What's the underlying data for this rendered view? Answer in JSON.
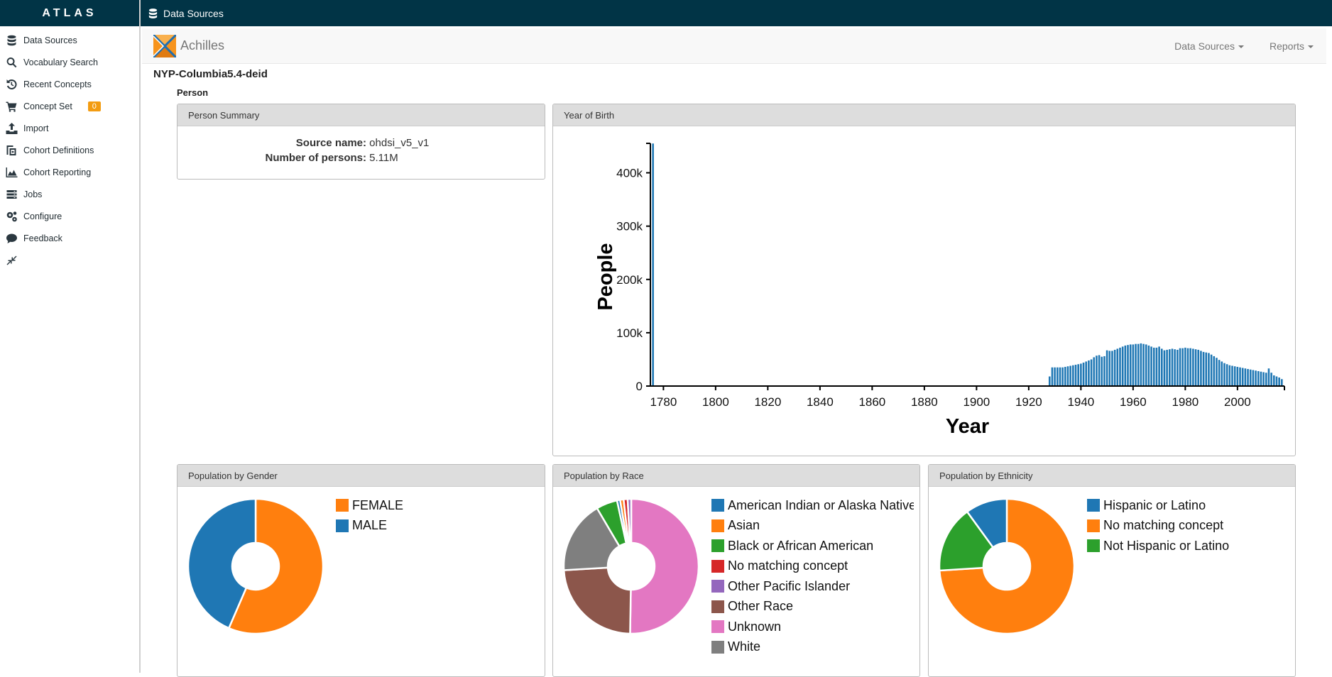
{
  "app": {
    "brand": "ATLAS",
    "page_title": "Data Sources"
  },
  "sidebar": {
    "items": [
      {
        "label": "Data Sources",
        "icon": "database-icon"
      },
      {
        "label": "Vocabulary Search",
        "icon": "search-icon"
      },
      {
        "label": "Recent Concepts",
        "icon": "history-icon"
      },
      {
        "label": "Concept Set",
        "icon": "cart-icon",
        "badge": "0"
      },
      {
        "label": "Import",
        "icon": "upload-icon"
      },
      {
        "label": "Cohort Definitions",
        "icon": "cohort-icon"
      },
      {
        "label": "Cohort Reporting",
        "icon": "area-chart-icon"
      },
      {
        "label": "Jobs",
        "icon": "jobs-icon"
      },
      {
        "label": "Configure",
        "icon": "gears-icon"
      },
      {
        "label": "Feedback",
        "icon": "comment-icon"
      },
      {
        "label": "",
        "icon": "compress-icon"
      }
    ]
  },
  "achilles": {
    "title": "Achilles",
    "menu_data_sources": "Data Sources",
    "menu_reports": "Reports"
  },
  "source": {
    "name": "NYP-Columbia5.4-deid",
    "section": "Person"
  },
  "summary": {
    "title": "Person Summary",
    "source_label": "Source name:",
    "source_value": "ohdsi_v5_v1",
    "persons_label": "Number of persons:",
    "persons_value": "5.11M"
  },
  "charts": {
    "yob_title": "Year of Birth",
    "gender_title": "Population by Gender",
    "race_title": "Population by Race",
    "ethnicity_title": "Population by Ethnicity"
  },
  "colors": {
    "navy": "#013446",
    "bar": "#1f77b4",
    "badge": "#f39c12"
  },
  "chart_data": [
    {
      "type": "bar",
      "title": "Year of Birth",
      "xlabel": "Year",
      "ylabel": "People",
      "xlim": [
        1775,
        2018
      ],
      "ylim": [
        0,
        450000
      ],
      "x_ticks": [
        "1780",
        "1800",
        "1820",
        "1840",
        "1860",
        "1880",
        "1900",
        "1920",
        "1940",
        "1960",
        "1980",
        "2000"
      ],
      "y_ticks": [
        "0",
        "100k",
        "200k",
        "300k",
        "400k"
      ],
      "x": [
        1776,
        1928,
        1929,
        1930,
        1931,
        1932,
        1933,
        1934,
        1935,
        1936,
        1937,
        1938,
        1939,
        1940,
        1941,
        1942,
        1943,
        1944,
        1945,
        1946,
        1947,
        1948,
        1949,
        1950,
        1951,
        1952,
        1953,
        1954,
        1955,
        1956,
        1957,
        1958,
        1959,
        1960,
        1961,
        1962,
        1963,
        1964,
        1965,
        1966,
        1967,
        1968,
        1969,
        1970,
        1971,
        1972,
        1973,
        1974,
        1975,
        1976,
        1977,
        1978,
        1979,
        1980,
        1981,
        1982,
        1983,
        1984,
        1985,
        1986,
        1987,
        1988,
        1989,
        1990,
        1991,
        1992,
        1993,
        1994,
        1995,
        1996,
        1997,
        1998,
        1999,
        2000,
        2001,
        2002,
        2003,
        2004,
        2005,
        2006,
        2007,
        2008,
        2009,
        2010,
        2011,
        2012,
        2013,
        2014,
        2015,
        2016,
        2017
      ],
      "values": [
        455000,
        18000,
        35000,
        35000,
        35000,
        35000,
        35000,
        36000,
        37000,
        38000,
        39000,
        40000,
        41000,
        42000,
        44000,
        46000,
        48000,
        50000,
        54000,
        57000,
        58000,
        55000,
        56000,
        67000,
        66000,
        66000,
        68000,
        70000,
        72000,
        74000,
        76000,
        77000,
        78000,
        78000,
        79000,
        79000,
        80000,
        79000,
        78000,
        76000,
        74000,
        72000,
        72000,
        74000,
        70000,
        67000,
        68000,
        69000,
        70000,
        69000,
        68000,
        71000,
        71000,
        72000,
        71000,
        71000,
        70000,
        69000,
        68000,
        66000,
        64000,
        63000,
        62000,
        59000,
        56000,
        53000,
        49000,
        46000,
        43000,
        41000,
        39000,
        38000,
        37000,
        36000,
        35000,
        34000,
        33000,
        32000,
        31000,
        30000,
        29000,
        28000,
        27000,
        26000,
        25000,
        33000,
        25000,
        20000,
        18000,
        16000,
        13000
      ]
    },
    {
      "type": "pie",
      "title": "Population by Gender",
      "categories": [
        "FEMALE",
        "MALE"
      ],
      "values": [
        56.5,
        43.5
      ],
      "colors": [
        "#ff7f0e",
        "#1f77b4"
      ]
    },
    {
      "type": "pie",
      "title": "Population by Race",
      "categories": [
        "American Indian or Alaska Native",
        "Asian",
        "Black or African American",
        "No matching concept",
        "Other Pacific Islander",
        "Other Race",
        "Unknown",
        "White"
      ],
      "values": [
        0.7,
        0.8,
        4.8,
        0.9,
        0.8,
        22.5,
        47.5,
        16.5
      ],
      "colors": [
        "#1f77b4",
        "#ff7f0e",
        "#2ca02c",
        "#d62728",
        "#9467bd",
        "#8c564b",
        "#e377c2",
        "#7f7f7f"
      ],
      "order": [
        6,
        5,
        7,
        2,
        0,
        1,
        3,
        4
      ]
    },
    {
      "type": "pie",
      "title": "Population by Ethnicity",
      "categories": [
        "Hispanic or Latino",
        "No matching concept",
        "Not Hispanic or Latino"
      ],
      "values": [
        10,
        74,
        16
      ],
      "colors": [
        "#1f77b4",
        "#ff7f0e",
        "#2ca02c"
      ],
      "order": [
        1,
        2,
        0
      ]
    }
  ]
}
